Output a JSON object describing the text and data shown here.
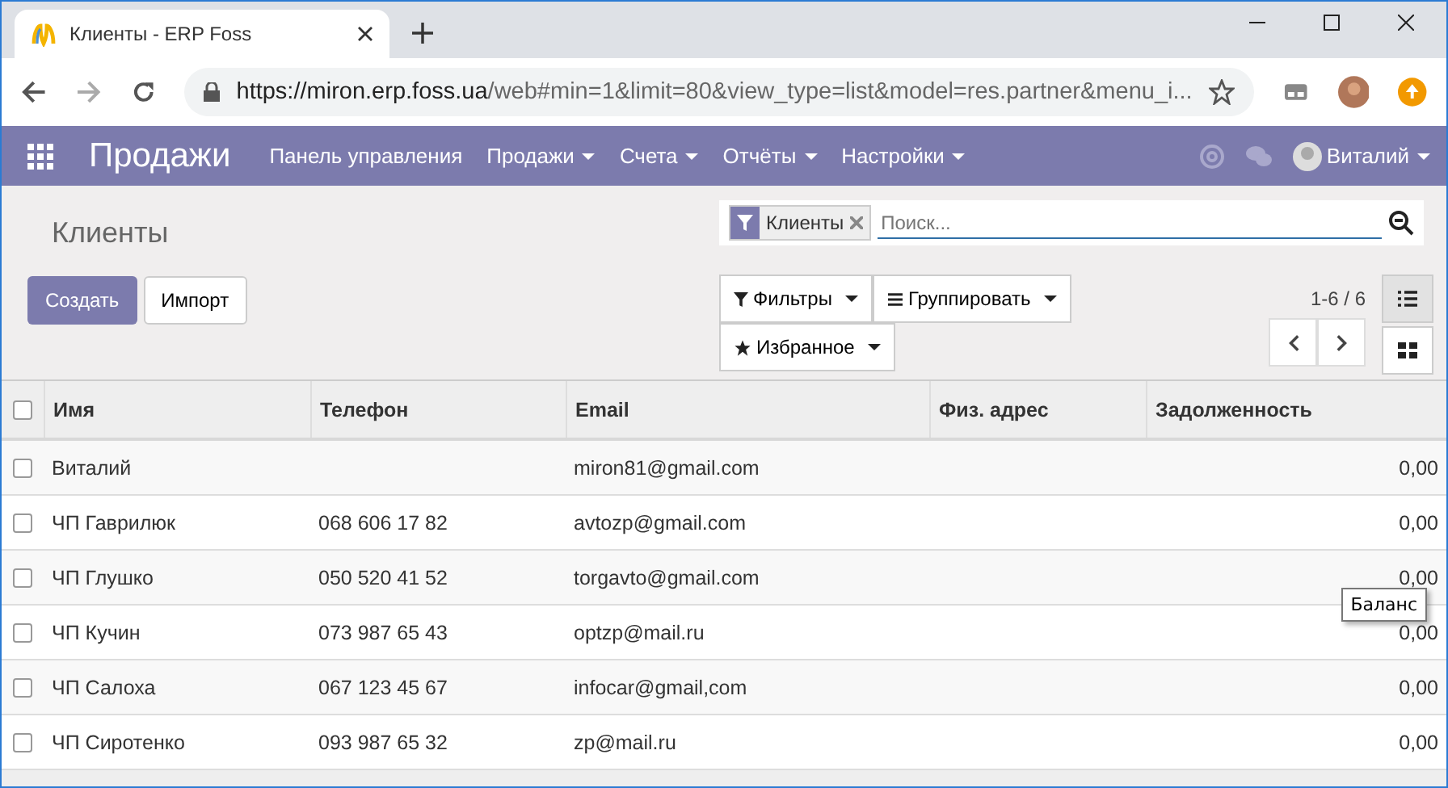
{
  "browser": {
    "tab_title": "Клиенты - ERP Foss",
    "url_host": "https://miron.erp.foss.ua",
    "url_rest": "/web#min=1&limit=80&view_type=list&model=res.partner&menu_i..."
  },
  "navbar": {
    "app": "Продажи",
    "menu": [
      {
        "label": "Панель управления",
        "dropdown": false
      },
      {
        "label": "Продажи",
        "dropdown": true
      },
      {
        "label": "Счета",
        "dropdown": true
      },
      {
        "label": "Отчёты",
        "dropdown": true
      },
      {
        "label": "Настройки",
        "dropdown": true
      }
    ],
    "user": "Виталий"
  },
  "control_panel": {
    "title": "Клиенты",
    "buttons": [
      "Создать",
      "Импорт"
    ],
    "facet": "Клиенты",
    "search": {
      "placeholder": "Поиск..."
    },
    "filters": [
      "Фильтры",
      "Группировать",
      "Избранное"
    ],
    "pager": "1-6 / 6",
    "views": [
      {
        "kind": "list",
        "selected": true
      },
      {
        "kind": "kanban",
        "selected": false
      }
    ]
  },
  "table": {
    "select_all_checked": false,
    "columns": [
      "Имя",
      "Телефон",
      "Email",
      "Физ. адрес",
      "Задолженность"
    ],
    "rows": [
      {
        "checked": false,
        "cells": [
          "Виталий",
          "",
          "miron81@gmail.com",
          "",
          "0,00"
        ]
      },
      {
        "checked": false,
        "cells": [
          "ЧП Гаврилюк",
          "068 606 17 82",
          "avtozp@gmail.com",
          "",
          "0,00"
        ]
      },
      {
        "checked": false,
        "cells": [
          "ЧП Глушко",
          "050 520 41 52",
          "torgavto@gmail.com",
          "",
          "0,00"
        ]
      },
      {
        "checked": false,
        "cells": [
          "ЧП Кучин",
          "073 987 65 43",
          "optzp@mail.ru",
          "",
          "0,00"
        ]
      },
      {
        "checked": false,
        "cells": [
          "ЧП Салоха",
          "067 123 45 67",
          "infocar@gmail,com",
          "",
          "0,00"
        ]
      },
      {
        "checked": false,
        "cells": [
          "ЧП Сиротенко",
          "093 987 65 32",
          "zp@mail.ru",
          "",
          "0,00"
        ]
      }
    ]
  },
  "tooltip": "Баланс"
}
